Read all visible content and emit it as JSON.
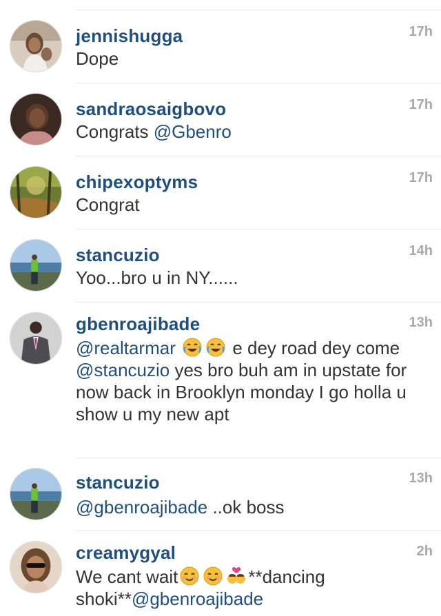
{
  "comments": [
    {
      "user": "jennishugga",
      "time": "17h",
      "text": "Dope"
    },
    {
      "user": "sandraosaigbovo",
      "time": "17h",
      "text_pre": "Congrats ",
      "mention": "@Gbenro"
    },
    {
      "user": "chipexoptyms",
      "time": "17h",
      "text": "Congrat"
    },
    {
      "user": "stancuzio",
      "time": "14h",
      "text": "Yoo...bro u in NY......"
    },
    {
      "user": "gbenroajibade",
      "time": "13h",
      "mention1": "@realtarmar",
      "text1": " e dey road dey come ",
      "mention2": "@stancuzio",
      "text2": " yes bro buh am in upstate for now back in Brooklyn monday I go holla u show u my new apt"
    },
    {
      "user": "stancuzio",
      "time": "13h",
      "mention": "@gbenroajibade",
      "text_post": " ..ok boss"
    },
    {
      "user": "creamygyal",
      "time": "2h",
      "text1": "We cant wait",
      "text2": "**dancing shoki**",
      "mention": "@gbenroajibade"
    }
  ],
  "icons": {
    "laugh": "tears-of-joy-icon",
    "smile": "smiling-face-icon",
    "kiss": "couple-kiss-icon"
  }
}
